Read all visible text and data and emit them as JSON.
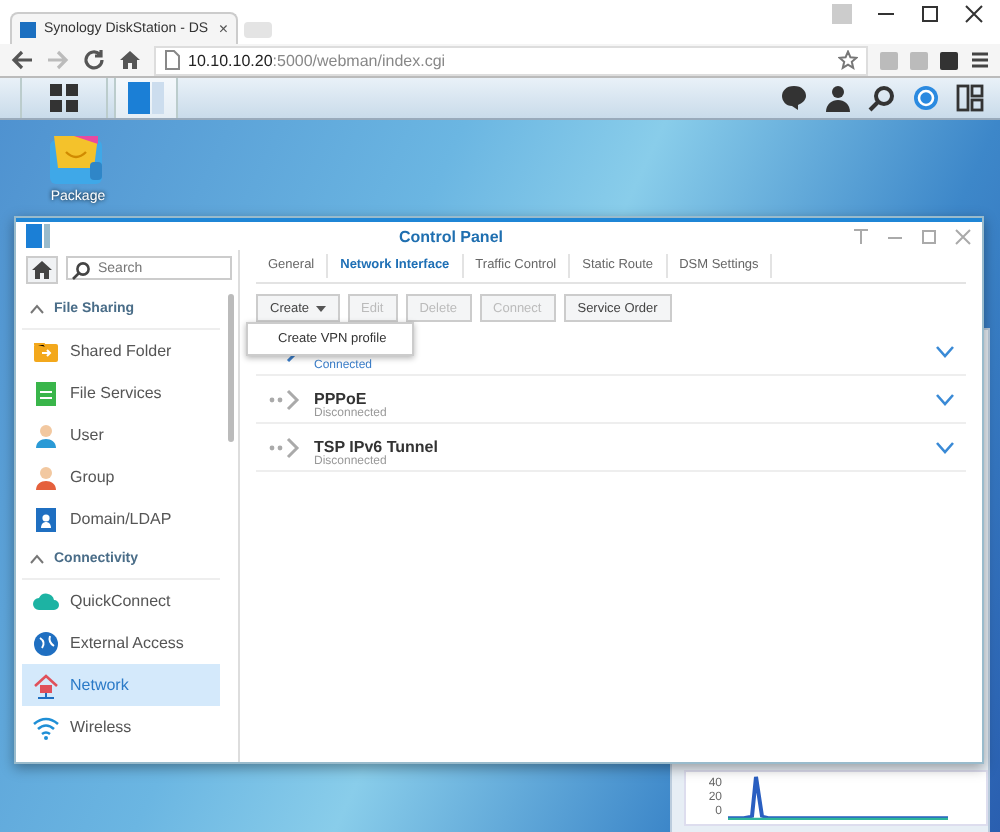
{
  "browser": {
    "tab_title": "Synology DiskStation - DS",
    "tab_close": "×",
    "url_host": "10.10.10.20",
    "url_path": ":5000/webman/index.cgi"
  },
  "desktop": {
    "shortcuts": [
      {
        "label": "Package"
      }
    ]
  },
  "widget": {
    "axis_labels": [
      "40",
      "20",
      "0"
    ]
  },
  "window": {
    "title": "Control Panel",
    "sidebar": {
      "search": {
        "placeholder": "Search"
      },
      "sections": [
        {
          "header": "File Sharing",
          "expanded": true,
          "items": [
            {
              "label": "Shared Folder",
              "selected": false
            },
            {
              "label": "File Services",
              "selected": false
            },
            {
              "label": "User",
              "selected": false
            },
            {
              "label": "Group",
              "selected": false
            },
            {
              "label": "Domain/LDAP",
              "selected": false
            }
          ]
        },
        {
          "header": "Connectivity",
          "expanded": true,
          "items": [
            {
              "label": "QuickConnect",
              "selected": false
            },
            {
              "label": "External Access",
              "selected": false
            },
            {
              "label": "Network",
              "selected": true
            },
            {
              "label": "Wireless",
              "selected": false
            }
          ]
        }
      ]
    },
    "tabs": [
      {
        "label": "General",
        "selected": false
      },
      {
        "label": "Network Interface",
        "selected": true
      },
      {
        "label": "Traffic Control",
        "selected": false
      },
      {
        "label": "Static Route",
        "selected": false
      },
      {
        "label": "DSM Settings",
        "selected": false
      }
    ],
    "toolbar": [
      {
        "label": "Create",
        "dropdown": true,
        "disabled": false
      },
      {
        "label": "Edit",
        "dropdown": false,
        "disabled": true
      },
      {
        "label": "Delete",
        "dropdown": false,
        "disabled": true
      },
      {
        "label": "Connect",
        "dropdown": false,
        "disabled": true
      },
      {
        "label": "Service Order",
        "dropdown": false,
        "disabled": false
      }
    ],
    "menu": [
      {
        "label": "Create VPN profile"
      }
    ],
    "interfaces": [
      {
        "status": "Connected",
        "connected": true
      },
      {
        "name": "PPPoE",
        "status": "Disconnected",
        "connected": false
      },
      {
        "name": "TSP IPv6 Tunnel",
        "status": "Disconnected",
        "connected": false
      }
    ]
  }
}
